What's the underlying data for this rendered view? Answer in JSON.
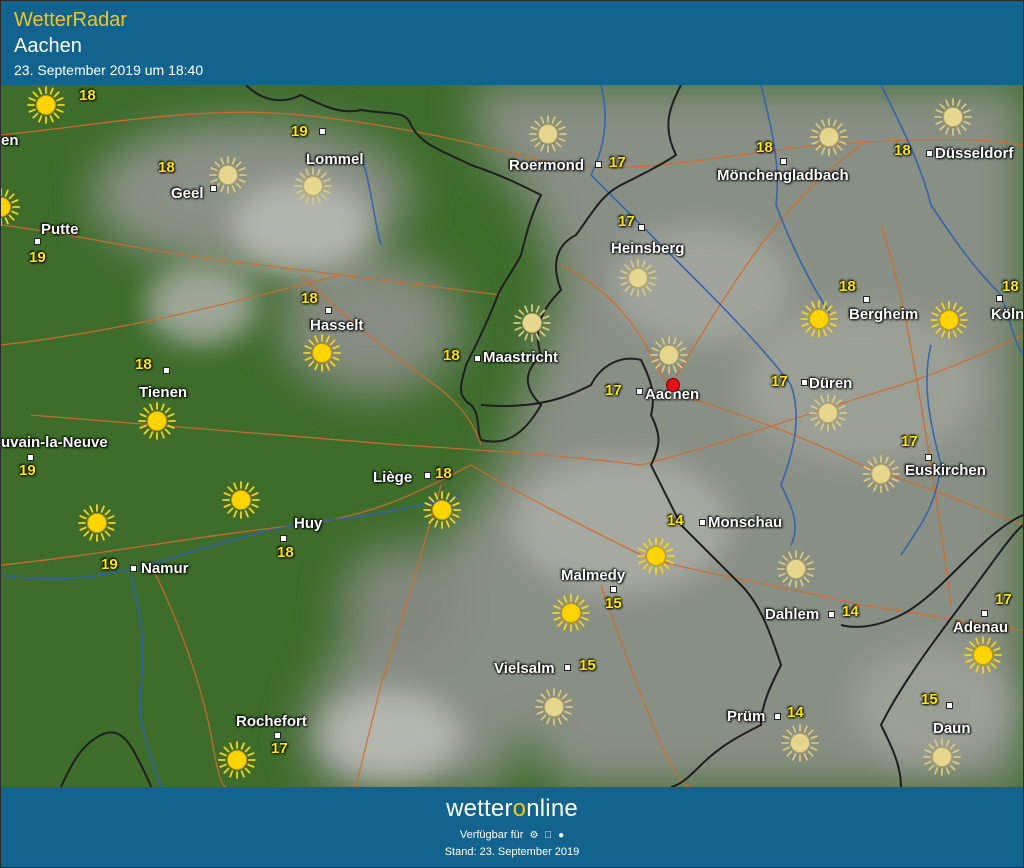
{
  "header": {
    "app_title": "WetterRadar",
    "location": "Aachen",
    "timestamp": "23. September 2019 um 18:40"
  },
  "footer": {
    "brand_before": "wetter",
    "brand_o": "o",
    "brand_after": "nline",
    "availability": "Verfügbar für",
    "platform_icons": [
      "android-icon",
      "apple-icon",
      "web-icon"
    ],
    "stand": "Stand: 23. September 2019"
  },
  "colors": {
    "header_bg": "#12638e",
    "accent_yellow": "#f2c521",
    "land_green": "#3c6b2a",
    "cloud_grey": "#8a8f86",
    "border_line": "#222222",
    "road_line": "#d36a2c",
    "river_line": "#2f5fb3",
    "pin_red": "#e3111a"
  },
  "marker": {
    "name": "Aachen",
    "icon": "location-pin-icon"
  },
  "cities": [
    {
      "id": "geel",
      "name": "Geel",
      "temp": "18"
    },
    {
      "id": "putte",
      "name": "Putte",
      "temp": "19"
    },
    {
      "id": "lommel",
      "name": "Lommel",
      "temp": "19"
    },
    {
      "id": "roermond",
      "name": "Roermond",
      "temp": "17"
    },
    {
      "id": "moenchengladbach",
      "name": "Mönchengladbach",
      "temp": "18"
    },
    {
      "id": "duesseldorf",
      "name": "Düsseldorf",
      "temp": "18"
    },
    {
      "id": "heinsberg",
      "name": "Heinsberg",
      "temp": "17"
    },
    {
      "id": "hasselt",
      "name": "Hasselt",
      "temp": "18"
    },
    {
      "id": "maastricht",
      "name": "Maastricht",
      "temp": "18"
    },
    {
      "id": "bergheim",
      "name": "Bergheim",
      "temp": "18"
    },
    {
      "id": "koeln",
      "name": "Köln",
      "temp": "18"
    },
    {
      "id": "tienen",
      "name": "Tienen",
      "temp": "18"
    },
    {
      "id": "aachen",
      "name": "Aachen",
      "temp": "17"
    },
    {
      "id": "dueren",
      "name": "Düren",
      "temp": "17"
    },
    {
      "id": "louvain",
      "name": "uvain-la-Neuve",
      "temp": "19"
    },
    {
      "id": "euskirchen",
      "name": "Euskirchen",
      "temp": "17"
    },
    {
      "id": "liege",
      "name": "Liège",
      "temp": "18"
    },
    {
      "id": "huy",
      "name": "Huy",
      "temp": "18"
    },
    {
      "id": "monschau",
      "name": "Monschau",
      "temp": "14"
    },
    {
      "id": "namur",
      "name": "Namur",
      "temp": "19"
    },
    {
      "id": "malmedy",
      "name": "Malmedy",
      "temp": "15"
    },
    {
      "id": "dahlem",
      "name": "Dahlem",
      "temp": "14"
    },
    {
      "id": "adenau",
      "name": "Adenau",
      "temp": "17"
    },
    {
      "id": "vielsalm",
      "name": "Vielsalm",
      "temp": "15"
    },
    {
      "id": "pruem",
      "name": "Prüm",
      "temp": "14"
    },
    {
      "id": "daun",
      "name": "Daun",
      "temp": "15"
    },
    {
      "id": "rochefort",
      "name": "Rochefort",
      "temp": "17"
    }
  ],
  "edge_labels": {
    "left_cut": "en",
    "left_temp": "18"
  },
  "weather_icon": "sun-icon"
}
